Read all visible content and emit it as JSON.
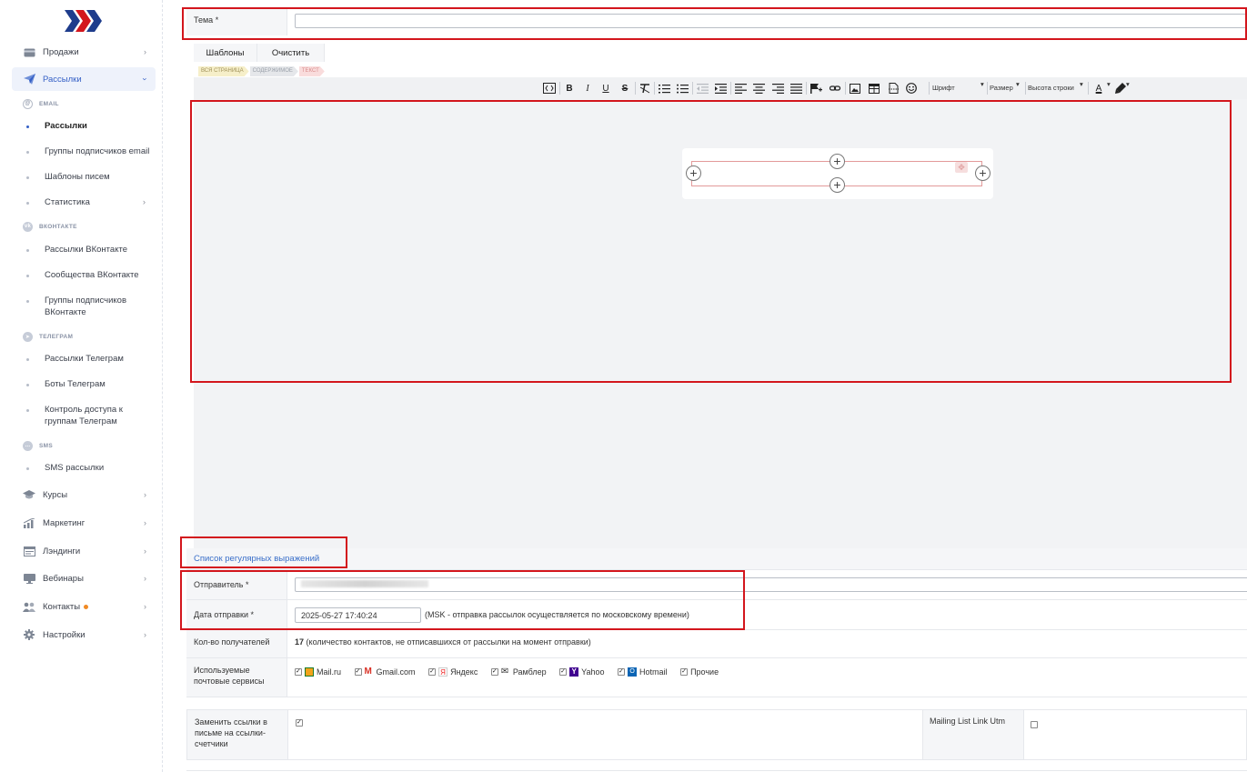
{
  "sidebar": {
    "items": {
      "sales": "Продажи",
      "mailings": "Рассылки",
      "courses": "Курсы",
      "marketing": "Маркетинг",
      "landings": "Лэндинги",
      "webinars": "Вебинары",
      "contacts": "Контакты",
      "settings": "Настройки"
    },
    "sections": {
      "email": "EMAIL",
      "vk": "ВКОНТАКТЕ",
      "telegram": "ТЕЛЕГРАМ",
      "sms": "SMS"
    },
    "subitems": {
      "email_mailings": "Рассылки",
      "email_groups": "Группы подписчиков email",
      "email_templates": "Шаблоны писем",
      "email_stats": "Статистика",
      "vk_mailings": "Рассылки ВКонтакте",
      "vk_communities": "Сообщества ВКонтакте",
      "vk_groups": "Группы подписчиков ВКонтакте",
      "tg_mailings": "Рассылки Телеграм",
      "tg_bots": "Боты Телеграм",
      "tg_access": "Контроль доступа к группам Телеграм",
      "sms_mailings": "SMS рассылки"
    }
  },
  "form": {
    "subject_label": "Тема *",
    "subject_value": "",
    "templates_btn": "Шаблоны",
    "clear_btn": "Очистить",
    "crumbs": [
      "ВСЯ СТРАНИЦА",
      "СОДЕРЖИМОЕ",
      "ТЕКСТ"
    ],
    "toolbar": {
      "bold": "B",
      "italic": "I",
      "underline": "U",
      "strike": "S",
      "font": "Шрифт",
      "size": "Размер",
      "line_height": "Высота строки",
      "text_color": "A"
    },
    "regex_link": "Список регулярных выражений",
    "sender_label": "Отправитель *",
    "sender_value": "",
    "date_label": "Дата отправки *",
    "date_value": "2025-05-27 17:40:24",
    "date_note": "(MSK - отправка рассылок осуществляется по московскому времени)",
    "recipients_label": "Кол-во получателей",
    "recipients_count": "17",
    "recipients_note": "(количество контактов, не отписавшихся от рассылки на момент отправки)",
    "services_label": "Используемые почтовые сервисы",
    "services": [
      "Mail.ru",
      "Gmail.com",
      "Яндекс",
      "Рамблер",
      "Yahoo",
      "Hotmail",
      "Прочие"
    ],
    "replace_links_label": "Заменить ссылки в письме на ссылки-счетчики",
    "utm_label": "Mailing List Link Utm"
  }
}
